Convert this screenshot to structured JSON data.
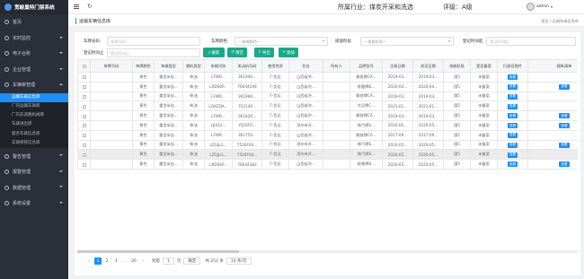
{
  "app": {
    "title": "宽峻巢特门禁系统"
  },
  "header": {
    "refresh_icon": "↻",
    "industry": "所属行业：煤炭开采和洗选",
    "rating": "评级：A级",
    "user": "admin"
  },
  "sidebar": {
    "items": [
      {
        "label": "首页"
      },
      {
        "label": "实时监控"
      },
      {
        "label": "电子台账"
      },
      {
        "label": "企业管理"
      },
      {
        "label": "车辆审管理"
      },
      {
        "label": "警告管理"
      },
      {
        "label": "报警管理"
      },
      {
        "label": "数据管理"
      },
      {
        "label": "系统设置"
      }
    ],
    "subitems": [
      {
        "label": "运输车辆信息库"
      },
      {
        "label": "厂内运输车辆库"
      },
      {
        "label": "厂内非道路机械库"
      },
      {
        "label": "车辆进出库"
      },
      {
        "label": "服务车辆信息库"
      },
      {
        "label": "车辆保管信息库"
      }
    ]
  },
  "breadcrumb": {
    "title": "运输车辆信息库",
    "path": "首页 / 运输车辆信息库"
  },
  "filters": {
    "plate_label": "车牌号码",
    "plate_placeholder": "车牌号码",
    "color_label": "车牌颜色",
    "color_placeholder": "—车牌颜色—",
    "stage_label": "排放阶段",
    "stage_placeholder": "—排放阶段—",
    "reg_start_label": "登记时间起",
    "reg_start_placeholder": "登记时间起",
    "reg_end_label": "登记时间止",
    "reg_end_placeholder": "登记时间止",
    "search": "搜索",
    "reset": "清空",
    "export": "导出",
    "add": "添加"
  },
  "table": {
    "columns": [
      "",
      "车牌号码",
      "车牌颜色",
      "车辆类型",
      "燃料类型",
      "车辆识别",
      "发动机号码",
      "使用性质",
      "住址",
      "所有人",
      "品牌型号",
      "注册日期",
      "发证日期",
      "排放阶段",
      "是否备案",
      "行驶证图片",
      "随车清单"
    ],
    "rows": [
      {
        "plate": "",
        "color": "黄色",
        "type": "重型半挂...",
        "fuel": "柴油",
        "vin": "LFWR...",
        "engine": "361940...",
        "usage": "F-货运",
        "addr": "山西省洪...",
        "owner": "",
        "model": "解放牌CA...",
        "reg": "2019-03...",
        "issue": "2019-03...",
        "stage": "国5",
        "filed": "未备案",
        "lic": "查看",
        "list": "",
        "gray": false
      },
      {
        "plate": "",
        "color": "黄色",
        "type": "重型半挂...",
        "fuel": "柴油",
        "vin": "LRDS6P...",
        "engine": "76644349",
        "usage": "F-货运",
        "addr": "山西省洪...",
        "owner": "",
        "model": "欧曼牌B...",
        "reg": "2020-04...",
        "issue": "2020-04...",
        "stage": "国5",
        "filed": "未备案",
        "lic": "查看",
        "list": "查看",
        "gray": false
      },
      {
        "plate": "",
        "color": "黄色",
        "type": "重型半挂...",
        "fuel": "柴油",
        "vin": "LFWR...",
        "engine": "361990...",
        "usage": "F-货运",
        "addr": "山西省洪...",
        "owner": "",
        "model": "解放牌CA...",
        "reg": "2019-03...",
        "issue": "2019-03...",
        "stage": "国5",
        "filed": "未备案",
        "lic": "查看",
        "list": "",
        "gray": false
      },
      {
        "plate": "",
        "color": "黄色",
        "type": "重型半挂...",
        "fuel": "柴油",
        "vin": "LGKZDA...",
        "engine": "752140...",
        "usage": "F-货运",
        "addr": "山西省洪...",
        "owner": "",
        "model": "大运牌C...",
        "reg": "2021-01...",
        "issue": "2021-01...",
        "stage": "国5",
        "filed": "未备案",
        "lic": "查看",
        "list": "",
        "gray": false
      },
      {
        "plate": "",
        "color": "黄色",
        "type": "重型半挂...",
        "fuel": "柴油",
        "vin": "LFWR...",
        "engine": "361820...",
        "usage": "F-货运",
        "addr": "山西省洪...",
        "owner": "",
        "model": "解放牌CA...",
        "reg": "2019-03...",
        "issue": "2019-03...",
        "stage": "国5",
        "filed": "未备案",
        "lic": "查看",
        "list": "查看",
        "gray": false
      },
      {
        "plate": "",
        "color": "黄色",
        "type": "重型半挂...",
        "fuel": "柴油",
        "vin": "LJUGU...",
        "engine": "Y520F0...",
        "usage": "F-货运",
        "addr": "滨州市开...",
        "owner": "",
        "model": "陕汽牌S...",
        "reg": "2020-05...",
        "issue": "2020-05...",
        "stage": "国5",
        "filed": "未备案",
        "lic": "查看",
        "list": "查看",
        "gray": false
      },
      {
        "plate": "",
        "color": "黄色",
        "type": "重型半挂...",
        "fuel": "柴油",
        "vin": "LFWR...",
        "engine": "361750...",
        "usage": "F-货运",
        "addr": "山西省洪...",
        "owner": "",
        "model": "解放牌CA...",
        "reg": "2017-09...",
        "issue": "2017-09...",
        "stage": "国5",
        "filed": "未备案",
        "lic": "查看",
        "list": "",
        "gray": false
      },
      {
        "plate": "",
        "color": "黄色",
        "type": "重型半挂...",
        "fuel": "柴油",
        "vin": "LZGJLG...",
        "engine": "7520F04...",
        "usage": "F-货运",
        "addr": "滨州市开...",
        "owner": "",
        "model": "陕汽牌S...",
        "reg": "2020-05...",
        "issue": "2020-05...",
        "stage": "国5",
        "filed": "未备案",
        "lic": "查看",
        "list": "查看",
        "gray": false
      },
      {
        "plate": "",
        "color": "黄色",
        "type": "重型半挂...",
        "fuel": "柴油",
        "vin": "LZGJLG...",
        "engine": "7520F04...",
        "usage": "F-货运",
        "addr": "滨州市开...",
        "owner": "",
        "model": "陕汽牌S...",
        "reg": "2020-05...",
        "issue": "2020-05...",
        "stage": "国5",
        "filed": "未备案",
        "lic": "查看",
        "list": "",
        "gray": true
      },
      {
        "plate": "",
        "color": "黄色",
        "type": "重型半挂...",
        "fuel": "柴油",
        "vin": "LRDS6P...",
        "engine": "76644383",
        "usage": "F-货运",
        "addr": "山西省洪...",
        "owner": "",
        "model": "欧曼牌B...",
        "reg": "2020-05...",
        "issue": "2020-05...",
        "stage": "国5",
        "filed": "未备案",
        "lic": "查看",
        "list": "查看",
        "gray": false
      }
    ]
  },
  "pagination": {
    "prev": "‹",
    "pages": [
      "1",
      "2",
      "3",
      "...",
      "26"
    ],
    "next": "›",
    "goto_label": "到第",
    "goto_value": "1",
    "goto_unit": "页",
    "confirm": "确定",
    "total": "共 252 条",
    "page_size": "10 条/页"
  },
  "colors": {
    "sidebar": "#2b2f3a",
    "accent": "#1890ff",
    "action": "#1aaa8a"
  }
}
